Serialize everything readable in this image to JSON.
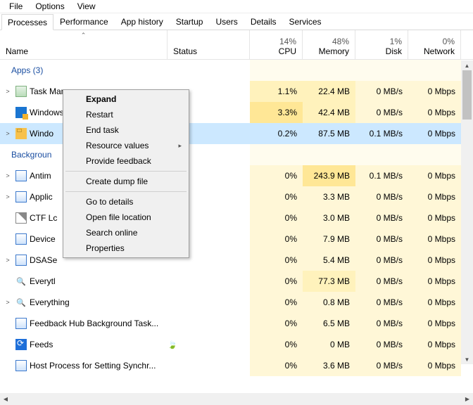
{
  "menubar": [
    "File",
    "Options",
    "View"
  ],
  "tabs": [
    "Processes",
    "Performance",
    "App history",
    "Startup",
    "Users",
    "Details",
    "Services"
  ],
  "active_tab": 0,
  "columns": {
    "name": "Name",
    "status": "Status",
    "cpu": {
      "pct": "14%",
      "label": "CPU"
    },
    "memory": {
      "pct": "48%",
      "label": "Memory"
    },
    "disk": {
      "pct": "1%",
      "label": "Disk"
    },
    "network": {
      "pct": "0%",
      "label": "Network"
    }
  },
  "groups": {
    "apps": "Apps (3)",
    "background": "Backgroun"
  },
  "rows": [
    {
      "chev": true,
      "icon": "tm",
      "name": "Task Manager",
      "cpu": "1.1%",
      "mem": "22.4 MB",
      "disk": "0 MB/s",
      "net": "0 Mbps",
      "cbg": "bg1",
      "mbg": "bg1",
      "dbg": "bg0",
      "nbg": "bg0"
    },
    {
      "chev": false,
      "icon": "gad",
      "name": "Windows Desktop Gadgets",
      "cpu": "3.3%",
      "mem": "42.4 MB",
      "disk": "0 MB/s",
      "net": "0 Mbps",
      "cbg": "bg2",
      "mbg": "bg1",
      "dbg": "bg0",
      "nbg": "bg0"
    },
    {
      "chev": true,
      "icon": "winex",
      "name": "Windo",
      "cpu": "0.2%",
      "mem": "87.5 MB",
      "disk": "0.1 MB/s",
      "net": "0 Mbps",
      "cbg": "bg0",
      "mbg": "bg1",
      "dbg": "bg0",
      "nbg": "bg0",
      "sel": true
    }
  ],
  "bgrows": [
    {
      "chev": true,
      "icon": "box",
      "name": "Antim",
      "cpu": "0%",
      "mem": "243.9 MB",
      "disk": "0.1 MB/s",
      "net": "0 Mbps",
      "cbg": "bg0",
      "mbg": "bg2",
      "dbg": "bg0",
      "nbg": "bg0"
    },
    {
      "chev": true,
      "icon": "box",
      "name": "Applic",
      "cpu": "0%",
      "mem": "3.3 MB",
      "disk": "0 MB/s",
      "net": "0 Mbps",
      "cbg": "bg0",
      "mbg": "bg0",
      "dbg": "bg0",
      "nbg": "bg0"
    },
    {
      "chev": false,
      "icon": "pen",
      "name": "CTF Lc",
      "cpu": "0%",
      "mem": "3.0 MB",
      "disk": "0 MB/s",
      "net": "0 Mbps",
      "cbg": "bg0",
      "mbg": "bg0",
      "dbg": "bg0",
      "nbg": "bg0"
    },
    {
      "chev": false,
      "icon": "box",
      "name": "Device",
      "cpu": "0%",
      "mem": "7.9 MB",
      "disk": "0 MB/s",
      "net": "0 Mbps",
      "cbg": "bg0",
      "mbg": "bg0",
      "dbg": "bg0",
      "nbg": "bg0"
    },
    {
      "chev": true,
      "icon": "box",
      "name": "DSASe",
      "cpu": "0%",
      "mem": "5.4 MB",
      "disk": "0 MB/s",
      "net": "0 Mbps",
      "cbg": "bg0",
      "mbg": "bg0",
      "dbg": "bg0",
      "nbg": "bg0"
    },
    {
      "chev": false,
      "icon": "mag",
      "name": "Everytl",
      "cpu": "0%",
      "mem": "77.3 MB",
      "disk": "0 MB/s",
      "net": "0 Mbps",
      "cbg": "bg0",
      "mbg": "bg1",
      "dbg": "bg0",
      "nbg": "bg0"
    },
    {
      "chev": true,
      "icon": "mag",
      "name": "Everything",
      "cpu": "0%",
      "mem": "0.8 MB",
      "disk": "0 MB/s",
      "net": "0 Mbps",
      "cbg": "bg0",
      "mbg": "bg0",
      "dbg": "bg0",
      "nbg": "bg0"
    },
    {
      "chev": false,
      "icon": "box",
      "name": "Feedback Hub Background Task...",
      "cpu": "0%",
      "mem": "6.5 MB",
      "disk": "0 MB/s",
      "net": "0 Mbps",
      "cbg": "bg0",
      "mbg": "bg0",
      "dbg": "bg0",
      "nbg": "bg0"
    },
    {
      "chev": false,
      "icon": "feeds",
      "name": "Feeds",
      "leaf": true,
      "cpu": "0%",
      "mem": "0 MB",
      "disk": "0 MB/s",
      "net": "0 Mbps",
      "cbg": "bg0",
      "mbg": "bg0",
      "dbg": "bg0",
      "nbg": "bg0"
    },
    {
      "chev": false,
      "icon": "box",
      "name": "Host Process for Setting Synchr...",
      "cpu": "0%",
      "mem": "3.6 MB",
      "disk": "0 MB/s",
      "net": "0 Mbps",
      "cbg": "bg0",
      "mbg": "bg0",
      "dbg": "bg0",
      "nbg": "bg0"
    }
  ],
  "context_menu": {
    "items": [
      {
        "label": "Expand",
        "default": true
      },
      {
        "label": "Restart"
      },
      {
        "label": "End task"
      },
      {
        "label": "Resource values",
        "submenu": true
      },
      {
        "label": "Provide feedback"
      },
      {
        "sep": true
      },
      {
        "label": "Create dump file"
      },
      {
        "sep": true
      },
      {
        "label": "Go to details"
      },
      {
        "label": "Open file location"
      },
      {
        "label": "Search online"
      },
      {
        "label": "Properties"
      }
    ]
  }
}
